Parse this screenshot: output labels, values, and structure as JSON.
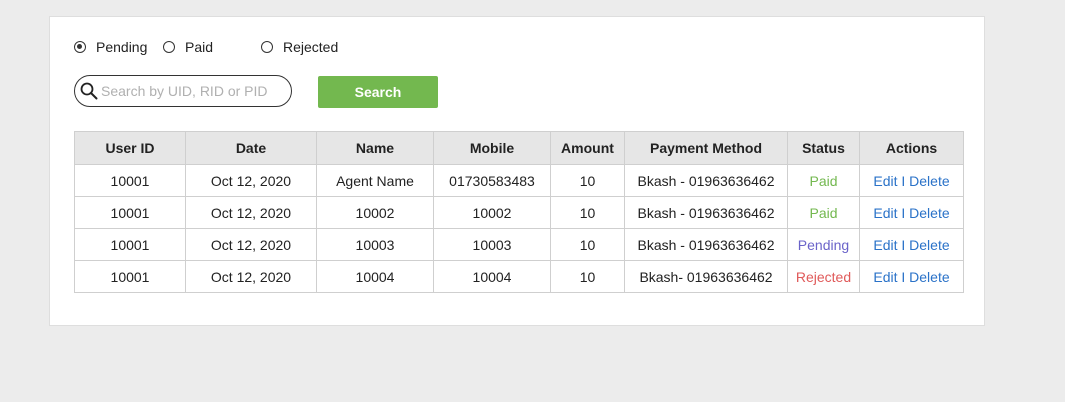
{
  "filters": {
    "options": [
      {
        "label": "Pending",
        "checked": true
      },
      {
        "label": "Paid",
        "checked": false
      },
      {
        "label": "Rejected",
        "checked": false
      }
    ]
  },
  "search": {
    "placeholder": "Search by UID, RID or PID",
    "value": "",
    "button_label": "Search"
  },
  "table": {
    "columns": [
      "User ID",
      "Date",
      "Name",
      "Mobile",
      "Amount",
      "Payment Method",
      "Status",
      "Actions"
    ],
    "rows": [
      {
        "user_id": "10001",
        "date": "Oct 12, 2020",
        "name": "Agent Name",
        "mobile": "01730583483",
        "amount": "10",
        "payment_method": "Bkash - 01963636462",
        "status": "Paid",
        "status_type": "paid",
        "edit": "Edit",
        "sep": " I ",
        "delete": "Delete"
      },
      {
        "user_id": "10001",
        "date": "Oct 12, 2020",
        "name": "10002",
        "mobile": "10002",
        "amount": "10",
        "payment_method": "Bkash - 01963636462",
        "status": "Paid",
        "status_type": "paid",
        "edit": "Edit",
        "sep": " I ",
        "delete": "Delete"
      },
      {
        "user_id": "10001",
        "date": "Oct 12, 2020",
        "name": "10003",
        "mobile": "10003",
        "amount": "10",
        "payment_method": "Bkash - 01963636462",
        "status": "Pending",
        "status_type": "pending",
        "edit": "Edit",
        "sep": " I ",
        "delete": "Delete"
      },
      {
        "user_id": "10001",
        "date": "Oct 12, 2020",
        "name": "10004",
        "mobile": "10004",
        "amount": "10",
        "payment_method": "Bkash- 01963636462",
        "status": "Rejected",
        "status_type": "rejected",
        "edit": "Edit",
        "sep": " I ",
        "delete": "Delete"
      }
    ]
  },
  "colors": {
    "background": "#ececec",
    "card": "#ffffff",
    "search_button": "#73b84f",
    "header_bg": "#e6e6e6",
    "status_paid": "#73b84f",
    "status_pending": "#6a63c9",
    "status_rejected": "#e05a5a",
    "link": "#2a72c8"
  }
}
